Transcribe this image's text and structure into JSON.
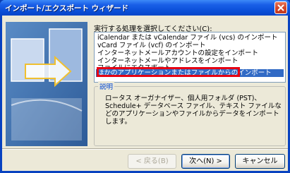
{
  "window": {
    "title": "インポート/エクスポート ウィザード"
  },
  "prompt": {
    "text": "実行する処理を選択してください",
    "accel": "(C):"
  },
  "list": {
    "items": [
      "iCalendar または vCalendar ファイル (vcs) のインポート",
      "vCard ファイル (vcf) のインポート",
      "インターネットメールアカウントの設定をインポート",
      "インターネットメールやアドレスをインポート",
      "ファイルにエクスポート",
      "ほかのアプリケーションまたはファイルからのインポート"
    ],
    "selected_index": 5
  },
  "description": {
    "legend": "説明",
    "text": "ロータス オーガナイザー、個人用フォルダ (PST)、Schedule+ データベース ファイル、テキスト ファイルなどのアプリケーションやファイルからデータをインポートします。"
  },
  "buttons": {
    "back": "< 戻る(B)",
    "next": "次へ(N) >",
    "cancel": "キャンセル"
  },
  "colors": {
    "highlight": "#e60012",
    "selection": "#316ac5"
  }
}
